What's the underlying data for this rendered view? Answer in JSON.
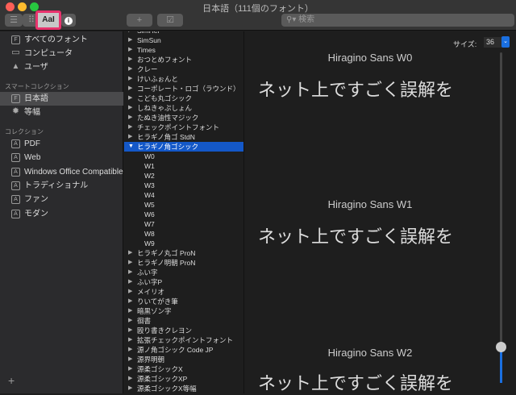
{
  "window": {
    "title": "日本語（111個のフォント）"
  },
  "toolbar": {
    "add_label": "+",
    "validate_label": "☑",
    "search_placeholder": "検索",
    "aa_label": "AaI",
    "info_label": "i"
  },
  "sidebar": {
    "items": [
      {
        "label": "すべてのフォント",
        "icon": "F"
      },
      {
        "label": "コンピュータ",
        "icon": "▭"
      },
      {
        "label": "ユーザ",
        "icon": "▲"
      }
    ],
    "smart_header": "スマートコレクション",
    "smart": [
      {
        "label": "日本語",
        "icon": "F"
      },
      {
        "label": "等幅",
        "icon": "✹"
      }
    ],
    "collections_header": "コレクション",
    "collections": [
      {
        "label": "PDF",
        "icon": "A"
      },
      {
        "label": "Web",
        "icon": "A"
      },
      {
        "label": "Windows Office Compatible",
        "icon": "A"
      },
      {
        "label": "トラディショナル",
        "icon": "A"
      },
      {
        "label": "ファン",
        "icon": "A"
      },
      {
        "label": "モダン",
        "icon": "A"
      }
    ],
    "add_label": "+"
  },
  "fonts": [
    {
      "label": "SimHei"
    },
    {
      "label": "SimSun"
    },
    {
      "label": "Times"
    },
    {
      "label": "おつとめフォント"
    },
    {
      "label": "クレー"
    },
    {
      "label": "けいふぉんと"
    },
    {
      "label": "コーポレート・ロゴ（ラウンド）"
    },
    {
      "label": "こども丸ゴシック"
    },
    {
      "label": "しねきゃぷしょん"
    },
    {
      "label": "たぬき油性マジック"
    },
    {
      "label": "チェックポイントフォント"
    },
    {
      "label": "ヒラギノ角ゴ StdN"
    },
    {
      "label": "ヒラギノ角ゴシック",
      "expanded": true,
      "selected": true,
      "weights": [
        "W0",
        "W1",
        "W2",
        "W3",
        "W4",
        "W5",
        "W6",
        "W7",
        "W8",
        "W9"
      ]
    },
    {
      "label": "ヒラギノ丸ゴ ProN"
    },
    {
      "label": "ヒラギノ明朝 ProN"
    },
    {
      "label": "ふい字"
    },
    {
      "label": "ふい字P"
    },
    {
      "label": "メイリオ"
    },
    {
      "label": "りいてがき筆"
    },
    {
      "label": "暗黒ゾン字"
    },
    {
      "label": "徊書"
    },
    {
      "label": "殴り書きクレヨン"
    },
    {
      "label": "拡張チェックポイントフォント"
    },
    {
      "label": "源ノ角ゴシック Code JP"
    },
    {
      "label": "源界明朝"
    },
    {
      "label": "源柔ゴシックX"
    },
    {
      "label": "源柔ゴシックXP"
    },
    {
      "label": "源柔ゴシックX等幅"
    }
  ],
  "preview": {
    "size_label": "サイズ:",
    "size_value": "36",
    "size_slider_fraction": 0.11,
    "samples": [
      {
        "name": "Hiragino Sans W0",
        "text": "ネット上ですごく誤解を"
      },
      {
        "name": "Hiragino Sans W1",
        "text": "ネット上ですごく誤解を"
      },
      {
        "name": "Hiragino Sans W2",
        "text": "ネット上ですごく誤解を"
      }
    ]
  },
  "colors": {
    "accent": "#1458c8",
    "highlight": "#e8336d"
  }
}
